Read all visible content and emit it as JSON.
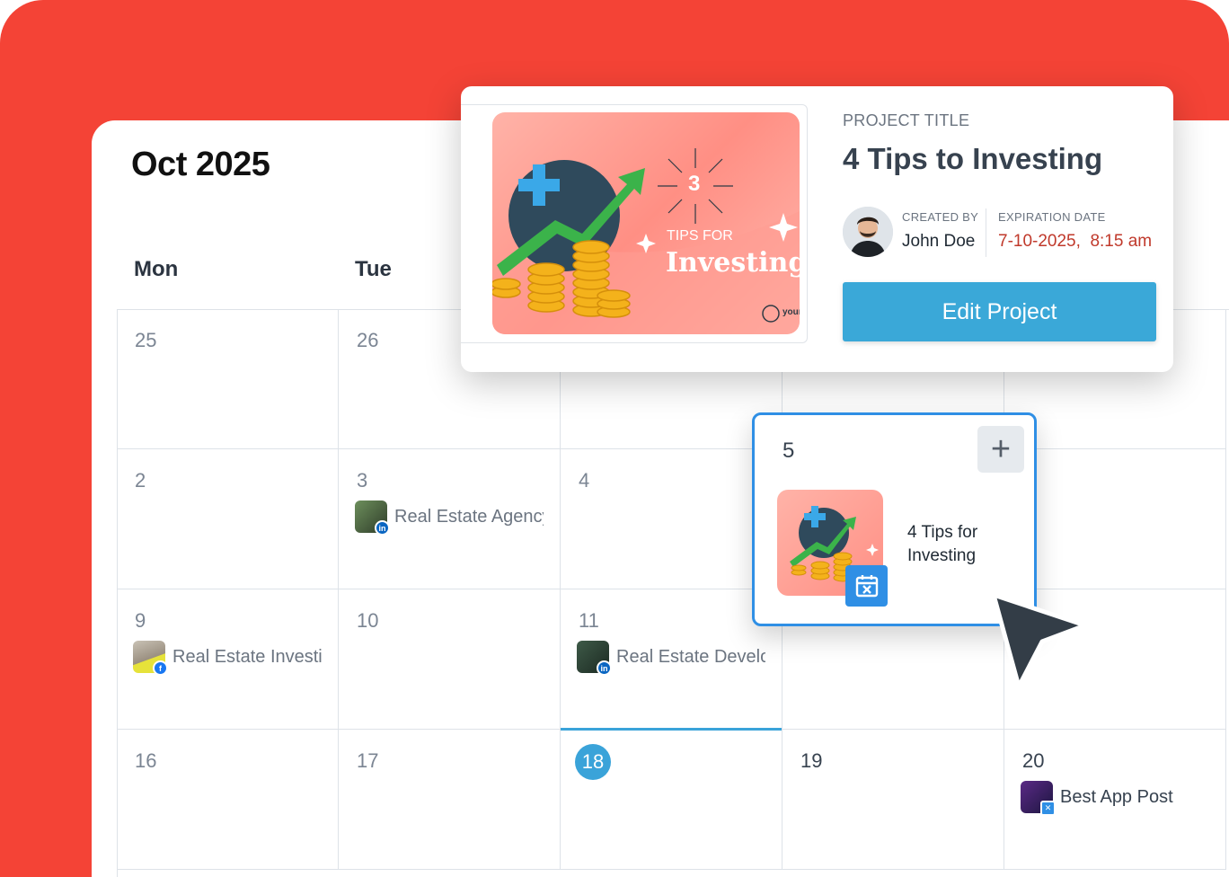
{
  "calendar": {
    "month_label": "Oct 2025",
    "weekdays": [
      "Mon",
      "Tue"
    ],
    "rows": [
      [
        "25",
        "26",
        "",
        "",
        ""
      ],
      [
        "2",
        "3",
        "4",
        "",
        ""
      ],
      [
        "9",
        "10",
        "11",
        "",
        ""
      ],
      [
        "16",
        "17",
        "18",
        "19",
        "20"
      ]
    ],
    "today": "18",
    "posts": {
      "oct3": {
        "label": "Real Estate Agency",
        "network": "linkedin"
      },
      "oct9": {
        "label": "Real Estate Investing",
        "network": "facebook"
      },
      "oct11": {
        "label": "Real Estate Development",
        "network": "linkedin"
      },
      "oct20": {
        "label": "Best App Post",
        "network": "scheduled"
      }
    }
  },
  "project_popup": {
    "section_label": "PROJECT TITLE",
    "title": "4 Tips to Investing",
    "created_by_label": "CREATED BY",
    "created_by": "John Doe",
    "expiration_label": "EXPIRATION DATE",
    "expiration_value": "7-10-2025,  8:15 am",
    "edit_button": "Edit Project",
    "image_text": {
      "number": "3",
      "line1": "TIPS FOR",
      "line2": "Investing",
      "brand": "your"
    }
  },
  "day_card": {
    "day": "5",
    "add_icon": "plus-icon",
    "post_title": "4 Tips for Investing"
  },
  "colors": {
    "brand_red": "#f44336",
    "accent_blue": "#3aa8d8",
    "card_border": "#2f8fe5",
    "expiration_red": "#c0392b"
  }
}
